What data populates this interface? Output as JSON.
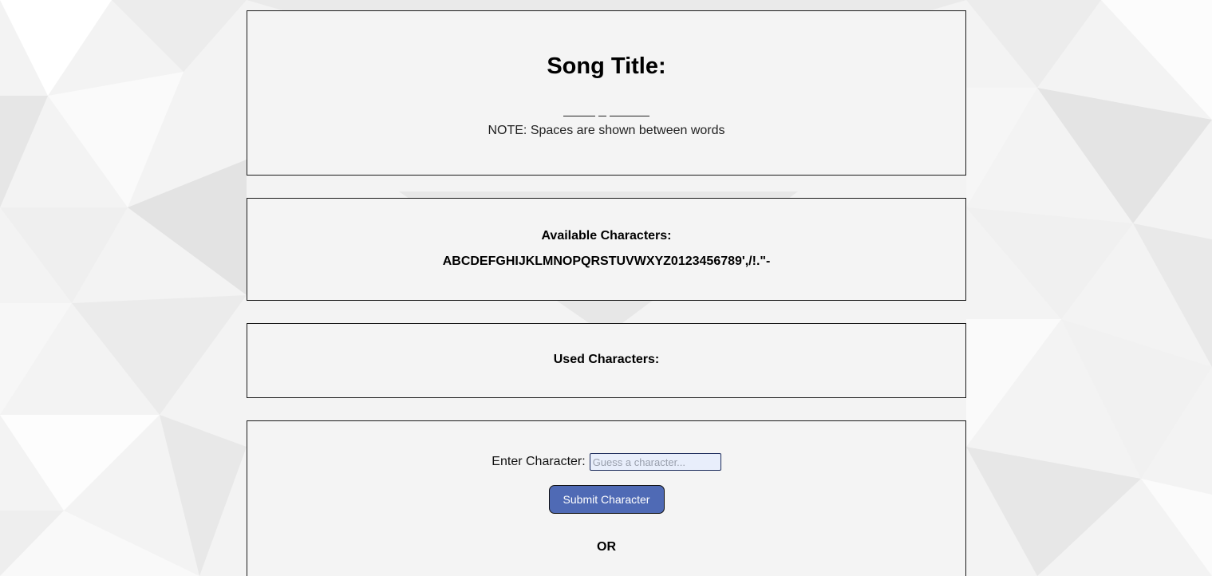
{
  "title_panel": {
    "heading": "Song Title:",
    "word_blanks": [
      4,
      1,
      5
    ],
    "note": "NOTE: Spaces are shown between words"
  },
  "available_panel": {
    "label": "Available Characters:",
    "characters": "ABCDEFGHIJKLMNOPQRSTUVWXYZ0123456789',/!.\"-"
  },
  "used_panel": {
    "label": "Used Characters:",
    "characters": ""
  },
  "entry_panel": {
    "input_label": "Enter Character:",
    "input_placeholder": "Guess a character...",
    "input_value": "",
    "submit_label": "Submit Character",
    "or_label": "OR"
  },
  "colors": {
    "accent_button": "#4f6ab5",
    "panel_background": "#f4f4f4",
    "input_background": "#e8eefb"
  }
}
